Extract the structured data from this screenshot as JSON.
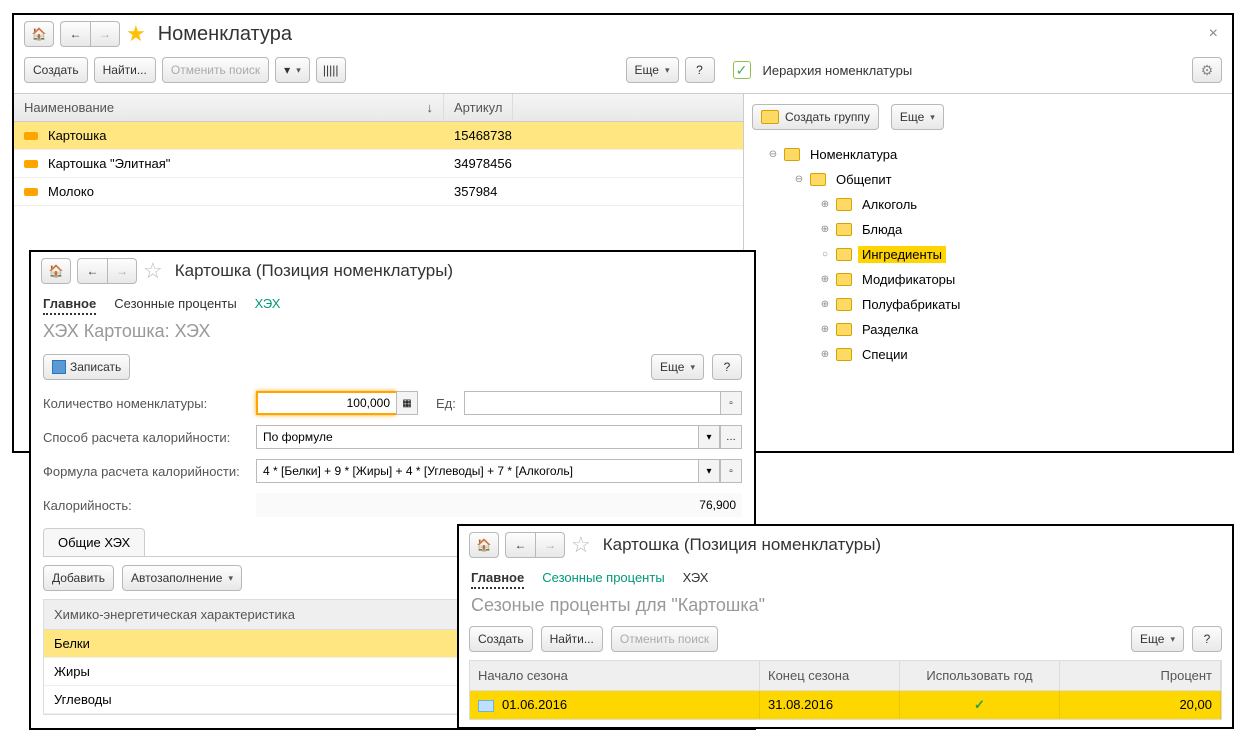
{
  "main": {
    "title": "Номенклатура",
    "close": "×",
    "toolbar": {
      "create": "Создать",
      "find": "Найти...",
      "cancel_search": "Отменить поиск",
      "more": "Еще",
      "help": "?",
      "hierarchy_label": "Иерархия номенклатуры"
    },
    "group_bar": {
      "create_group": "Создать группу",
      "more": "Еще"
    },
    "columns": {
      "name": "Наименование",
      "article": "Артикул"
    },
    "rows": [
      {
        "name": "Картошка",
        "article": "15468738",
        "selected": true
      },
      {
        "name": "Картошка \"Элитная\"",
        "article": "34978456",
        "selected": false
      },
      {
        "name": "Молоко",
        "article": "357984",
        "selected": false
      }
    ],
    "tree": {
      "root": "Номенклатура",
      "group": "Общепит",
      "items": [
        "Алкоголь",
        "Блюда",
        "Ингредиенты",
        "Модификаторы",
        "Полуфабрикаты",
        "Разделка",
        "Специи"
      ],
      "highlight": "Ингредиенты"
    }
  },
  "card": {
    "title": "Картошка (Позиция номенклатуры)",
    "tabs": {
      "main": "Главное",
      "season": "Сезонные проценты",
      "hex": "ХЭХ"
    },
    "subtitle": "ХЭХ Картошка: ХЭХ",
    "save": "Записать",
    "more": "Еще",
    "help": "?",
    "fields": {
      "qty_label": "Количество номенклатуры:",
      "qty_value": "100,000",
      "unit_label": "Ед:",
      "unit_value": "",
      "calc_label": "Способ расчета калорийности:",
      "calc_value": "По формуле",
      "formula_label": "Формула расчета калорийности:",
      "formula_value": "4 * [Белки] + 9 * [Жиры] + 4 * [Углеводы] + 7 * [Алкоголь]",
      "cal_label": "Калорийность:",
      "cal_value": "76,900"
    },
    "inner_tab": "Общие ХЭХ",
    "subbar": {
      "add": "Добавить",
      "autofill": "Автозаполнение"
    },
    "grid": {
      "header": "Химико-энергетическая характеристика",
      "rows": [
        "Белки",
        "Жиры",
        "Углеводы"
      ]
    }
  },
  "season": {
    "title": "Картошка (Позиция номенклатуры)",
    "tabs": {
      "main": "Главное",
      "season": "Сезонные проценты",
      "hex": "ХЭХ"
    },
    "subtitle": "Сезоные проценты для \"Картошка\"",
    "toolbar": {
      "create": "Создать",
      "find": "Найти...",
      "cancel_search": "Отменить поиск",
      "more": "Еще",
      "help": "?"
    },
    "cols": {
      "start": "Начало сезона",
      "end": "Конец сезона",
      "use_year": "Использовать год",
      "percent": "Процент"
    },
    "row": {
      "start": "01.06.2016",
      "end": "31.08.2016",
      "percent": "20,00"
    }
  }
}
